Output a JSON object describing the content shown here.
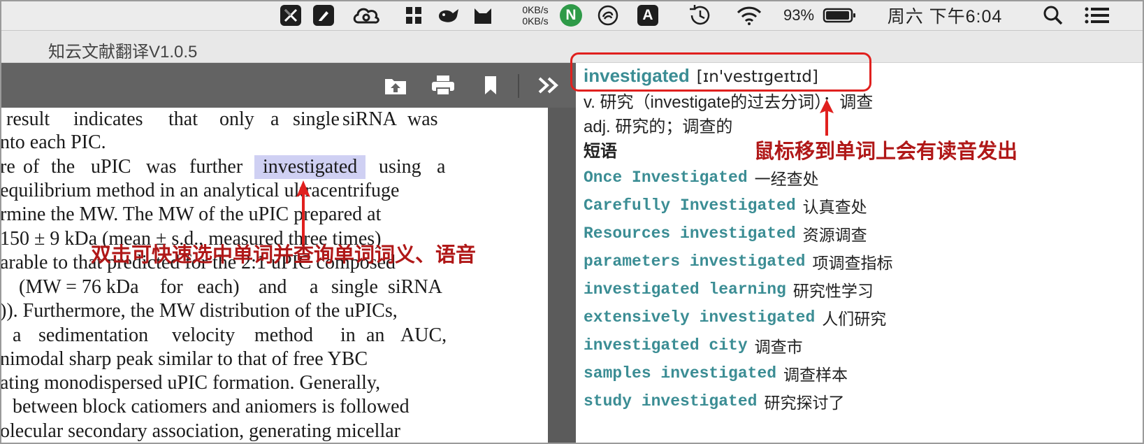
{
  "menubar": {
    "net_speed_up": "0KB/s",
    "net_speed_down": "0KB/s",
    "status_letter_n": "N",
    "status_letter_a": "A",
    "battery_percent": "93%",
    "clock": "周六 下午6:04",
    "icons": [
      "x-app-icon",
      "note-icon",
      "cloud-icon",
      "grid-icon",
      "whale-icon",
      "cat-icon",
      "network-speed",
      "n-badge-icon",
      "swirl-icon",
      "input-method-icon",
      "time-machine-icon",
      "wifi-icon",
      "battery-icon",
      "search-icon",
      "list-icon"
    ]
  },
  "window": {
    "title": "知云文献翻译V1.0.5"
  },
  "pdf_toolbar": {
    "icons": [
      "open-folder-icon",
      "print-icon",
      "bookmark-icon",
      "expand-chevrons-icon"
    ]
  },
  "pdf": {
    "lines": [
      {
        "parts": [
          "result",
          "indicates",
          "that",
          "only",
          "a",
          "single",
          "siRNA",
          "was"
        ]
      },
      {
        "parts": [
          "nto each PIC."
        ]
      },
      {
        "parts": [
          "re",
          "of",
          "the",
          "uPIC",
          "was",
          "further"
        ],
        "highlight": "investigated",
        "after": [
          "using",
          "a"
        ]
      },
      {
        "parts": [
          "equilibrium method in an analytical ultracentrifuge"
        ]
      },
      {
        "parts": [
          "rmine the MW. The MW of the uPIC prepared at"
        ]
      },
      {
        "parts": [
          "150 ± 9 kDa (mean ± s.d., measured three times)"
        ]
      },
      {
        "parts": [
          "arable to that predicted for the 2:1 uPIC composed"
        ]
      },
      {
        "parts": [
          "(MW = 76 kDa",
          "for",
          "each)",
          "and",
          "a",
          "single",
          "siRNA"
        ]
      },
      {
        "parts": [
          ")). Furthermore, the MW distribution of the uPICs,"
        ]
      },
      {
        "parts": [
          "a",
          "sedimentation",
          "velocity",
          "method",
          "in",
          "an",
          "AUC,"
        ]
      },
      {
        "parts": [
          "nimodal sharp peak similar to that of free YBC"
        ]
      },
      {
        "parts": [
          "ating monodispersed uPIC formation. Generally,"
        ]
      },
      {
        "parts": [
          "between block catiomers and aniomers is followed"
        ]
      },
      {
        "parts": [
          "olecular secondary association, generating micellar"
        ]
      }
    ]
  },
  "dict": {
    "headword": "investigated",
    "phonetic": "[ɪn'vestɪgeɪtɪd]",
    "definitions": [
      "v. 研究（investigate的过去分词）；调查",
      "adj. 研究的；调查的"
    ],
    "phrases_heading": "短语",
    "phrases": [
      {
        "en": "Once Investigated",
        "zh": "一经查处"
      },
      {
        "en": "Carefully Investigated",
        "zh": "认真查处"
      },
      {
        "en": "Resources investigated",
        "zh": "资源调查"
      },
      {
        "en": "parameters investigated",
        "zh": "项调查指标"
      },
      {
        "en": "investigated learning",
        "zh": "研究性学习"
      },
      {
        "en": "extensively investigated",
        "zh": "人们研究"
      },
      {
        "en": "investigated city",
        "zh": "调查市"
      },
      {
        "en": "samples investigated",
        "zh": "调查样本"
      },
      {
        "en": "study investigated",
        "zh": "研究探讨了"
      }
    ]
  },
  "annotations": {
    "left": "双击可快速选中单词并查询单词词义、语音",
    "right": "鼠标移到单词上会有读音发出",
    "color": "#e0201e"
  },
  "colors": {
    "accent_teal": "#3b8d94",
    "highlight": "#cfd0f3",
    "annotation_red": "#b01818"
  }
}
